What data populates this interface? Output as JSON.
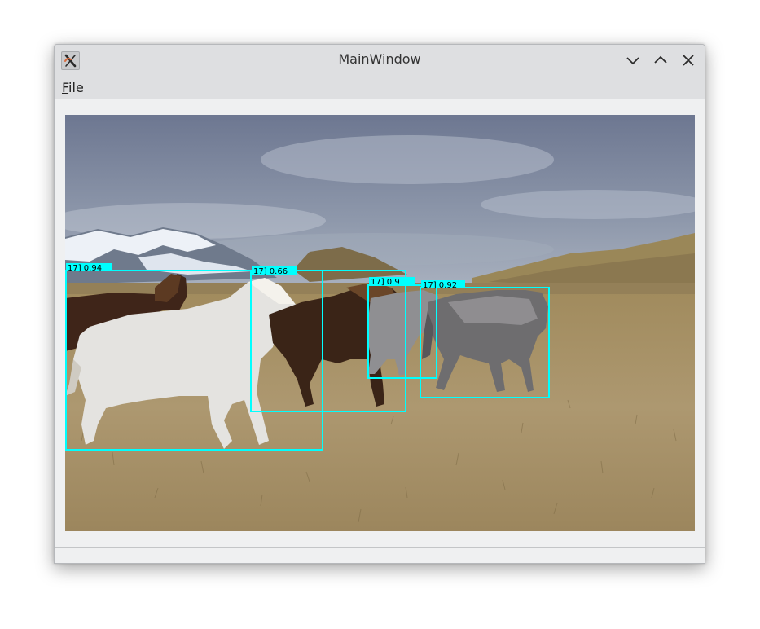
{
  "window": {
    "title": "MainWindow"
  },
  "menubar": {
    "file_mnemonic": "F",
    "file_rest": "ile"
  },
  "colors": {
    "box": "#00ffff",
    "sky_top": "#6c7690",
    "sky_bottom": "#a3acbb",
    "field": "#a8936a",
    "field_dark": "#8f7a52",
    "hill": "#9b8759",
    "snow": "#eef2f8",
    "mountain": "#6a7587"
  },
  "icons": {
    "app": "x-app-icon",
    "minimize": "chevron-down-icon",
    "maximize": "chevron-up-icon",
    "close": "close-icon"
  },
  "detections": [
    {
      "label": "17] 0.94"
    },
    {
      "label": "17] 0.66"
    },
    {
      "label": "17] 0.9"
    },
    {
      "label": "17] 0.92"
    }
  ]
}
